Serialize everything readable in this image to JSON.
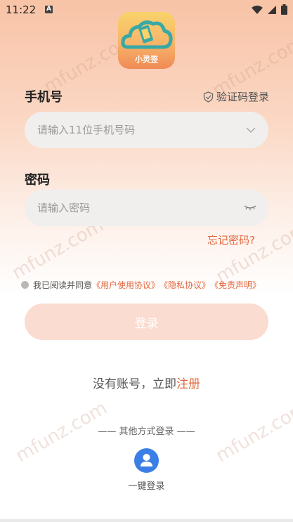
{
  "status_bar": {
    "time": "11:22",
    "notif_icon": "a-icon"
  },
  "app": {
    "logo_text": "小灵签"
  },
  "phone": {
    "label": "手机号",
    "placeholder": "请输入11位手机号码"
  },
  "sms_login": {
    "label": "验证码登录"
  },
  "password": {
    "label": "密码",
    "placeholder": "请输入密码"
  },
  "forgot": "忘记密码?",
  "agreement": {
    "prefix": "我已阅读并同意",
    "user_agreement": "《用户使用协议》",
    "privacy": "《隐私协议》",
    "disclaimer": "《免责声明》"
  },
  "login_button": "登录",
  "register": {
    "text": "没有账号，立即",
    "link": "注册"
  },
  "other_login": "—— 其他方式登录 ——",
  "one_key_login": "一键登录",
  "watermark": "mfunz.com",
  "colors": {
    "accent": "#e2683f",
    "button_bg": "#fbdcd0",
    "one_key_blue": "#3b7fe6"
  }
}
